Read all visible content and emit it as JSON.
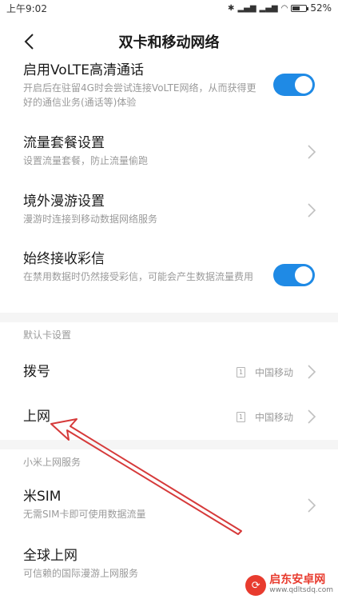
{
  "status_bar": {
    "time": "上午9:02",
    "battery": "52%",
    "battery_level": 0.52
  },
  "header": {
    "title": "双卡和移动网络"
  },
  "settings": {
    "volte": {
      "title": "启用VoLTE高清通话",
      "subtitle": "开启后在驻留4G时会尝试连接VoLTE网络，从而获得更好的通信业务(通话等)体验",
      "enabled": true
    },
    "data_plan": {
      "title": "流量套餐设置",
      "subtitle": "设置流量套餐，防止流量偷跑"
    },
    "roaming": {
      "title": "境外漫游设置",
      "subtitle": "漫游时连接到移动数据网络服务"
    },
    "mms": {
      "title": "始终接收彩信",
      "subtitle": "在禁用数据时仍然接受彩信，可能会产生数据流量费用",
      "enabled": true
    }
  },
  "default_card_section": {
    "header": "默认卡设置",
    "items": [
      {
        "title": "拨号",
        "sim_slot": "1",
        "carrier": "中国移动"
      },
      {
        "title": "上网",
        "sim_slot": "1",
        "carrier": "中国移动"
      }
    ]
  },
  "mi_internet_section": {
    "header": "小米上网服务",
    "items": [
      {
        "title": "米SIM",
        "subtitle": "无需SIM卡即可使用数据流量"
      },
      {
        "title": "全球上网",
        "subtitle": "可信赖的国际漫游上网服务"
      }
    ]
  },
  "watermark": {
    "name": "启东安卓网",
    "url": "www.qdltsdq.com"
  },
  "colors": {
    "accent": "#1f8ae5",
    "annotation_arrow": "#d63a3a"
  }
}
